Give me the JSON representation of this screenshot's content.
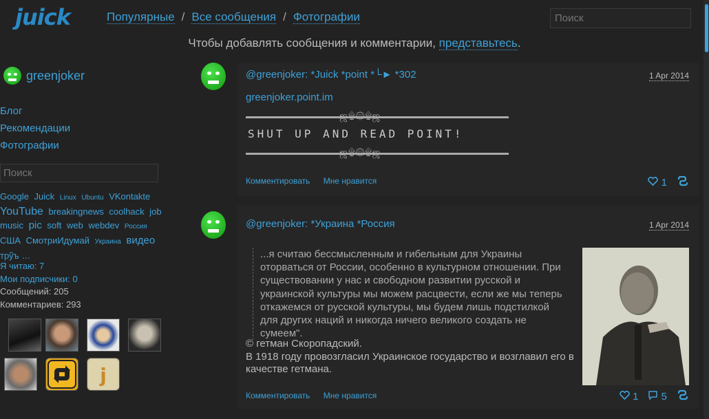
{
  "header": {
    "logo": "juick",
    "nav": [
      "Популярные",
      "Все сообщения",
      "Фотографии"
    ],
    "nav_sep": "/",
    "search_placeholder": "Поиск"
  },
  "notice": {
    "text": "Чтобы добавлять сообщения и комментарии, ",
    "link": "представьтесь",
    "end": "."
  },
  "sidebar": {
    "username": "greenjoker",
    "links": [
      "Блог",
      "Рекомендации",
      "Фотографии"
    ],
    "search_placeholder": "Поиск",
    "tags": [
      {
        "t": "Google",
        "s": 13
      },
      {
        "t": "Juick",
        "s": 13
      },
      {
        "t": "Linux",
        "s": 10
      },
      {
        "t": "Ubuntu",
        "s": 10
      },
      {
        "t": "VKontakte",
        "s": 13
      },
      {
        "t": "YouTube",
        "s": 16
      },
      {
        "t": "breakingnews",
        "s": 13
      },
      {
        "t": "coolhack",
        "s": 13
      },
      {
        "t": "job",
        "s": 13
      },
      {
        "t": "music",
        "s": 13
      },
      {
        "t": "pic",
        "s": 15
      },
      {
        "t": "soft",
        "s": 13
      },
      {
        "t": "web",
        "s": 13
      },
      {
        "t": "webdev",
        "s": 13
      },
      {
        "t": "Россия",
        "s": 10
      },
      {
        "t": "США",
        "s": 13
      },
      {
        "t": "СмотриИдумай",
        "s": 13
      },
      {
        "t": "Украина",
        "s": 10
      },
      {
        "t": "видео",
        "s": 15
      },
      {
        "t": "трўъ …",
        "s": 13
      }
    ],
    "reading": "Я читаю: 7",
    "subscribers": "Мои подписчики: 0",
    "messages": "Сообщений: 205",
    "comments": "Комментариев: 293"
  },
  "posts": [
    {
      "author": "@greenjoker:",
      "tags": [
        "*Juick",
        "*point",
        "*└►",
        "*302"
      ],
      "date": "1 Apr 2014",
      "link": "greenjoker.point.im",
      "ornament": "ஜ۩۞۩ஜ",
      "banner": "SHUT UP AND READ POINT!",
      "comment": "Комментировать",
      "like": "Мне нравится",
      "likes": "1",
      "replies": ""
    },
    {
      "author": "@greenjoker:",
      "tags": [
        "*Украина",
        "*Россия"
      ],
      "date": "1 Apr 2014",
      "quote": "...я считаю бессмысленным и гибельным для Украины оторваться от России, особенно в культурном отношении. При существовании у нас и свободном развитии русской и украинской культуры мы можем расцвести, если же мы теперь откажемся от русской культуры, мы будем лишь подстилкой для других наций и никогда ничего великого создать не сумеем\".",
      "text1": "© гетман Скоропадский.",
      "text2": "В 1918 году провозгласил Украинское государство и возглавил его в качестве гетмана.",
      "comment": "Комментировать",
      "like": "Мне нравится",
      "likes": "1",
      "replies": "5"
    }
  ]
}
